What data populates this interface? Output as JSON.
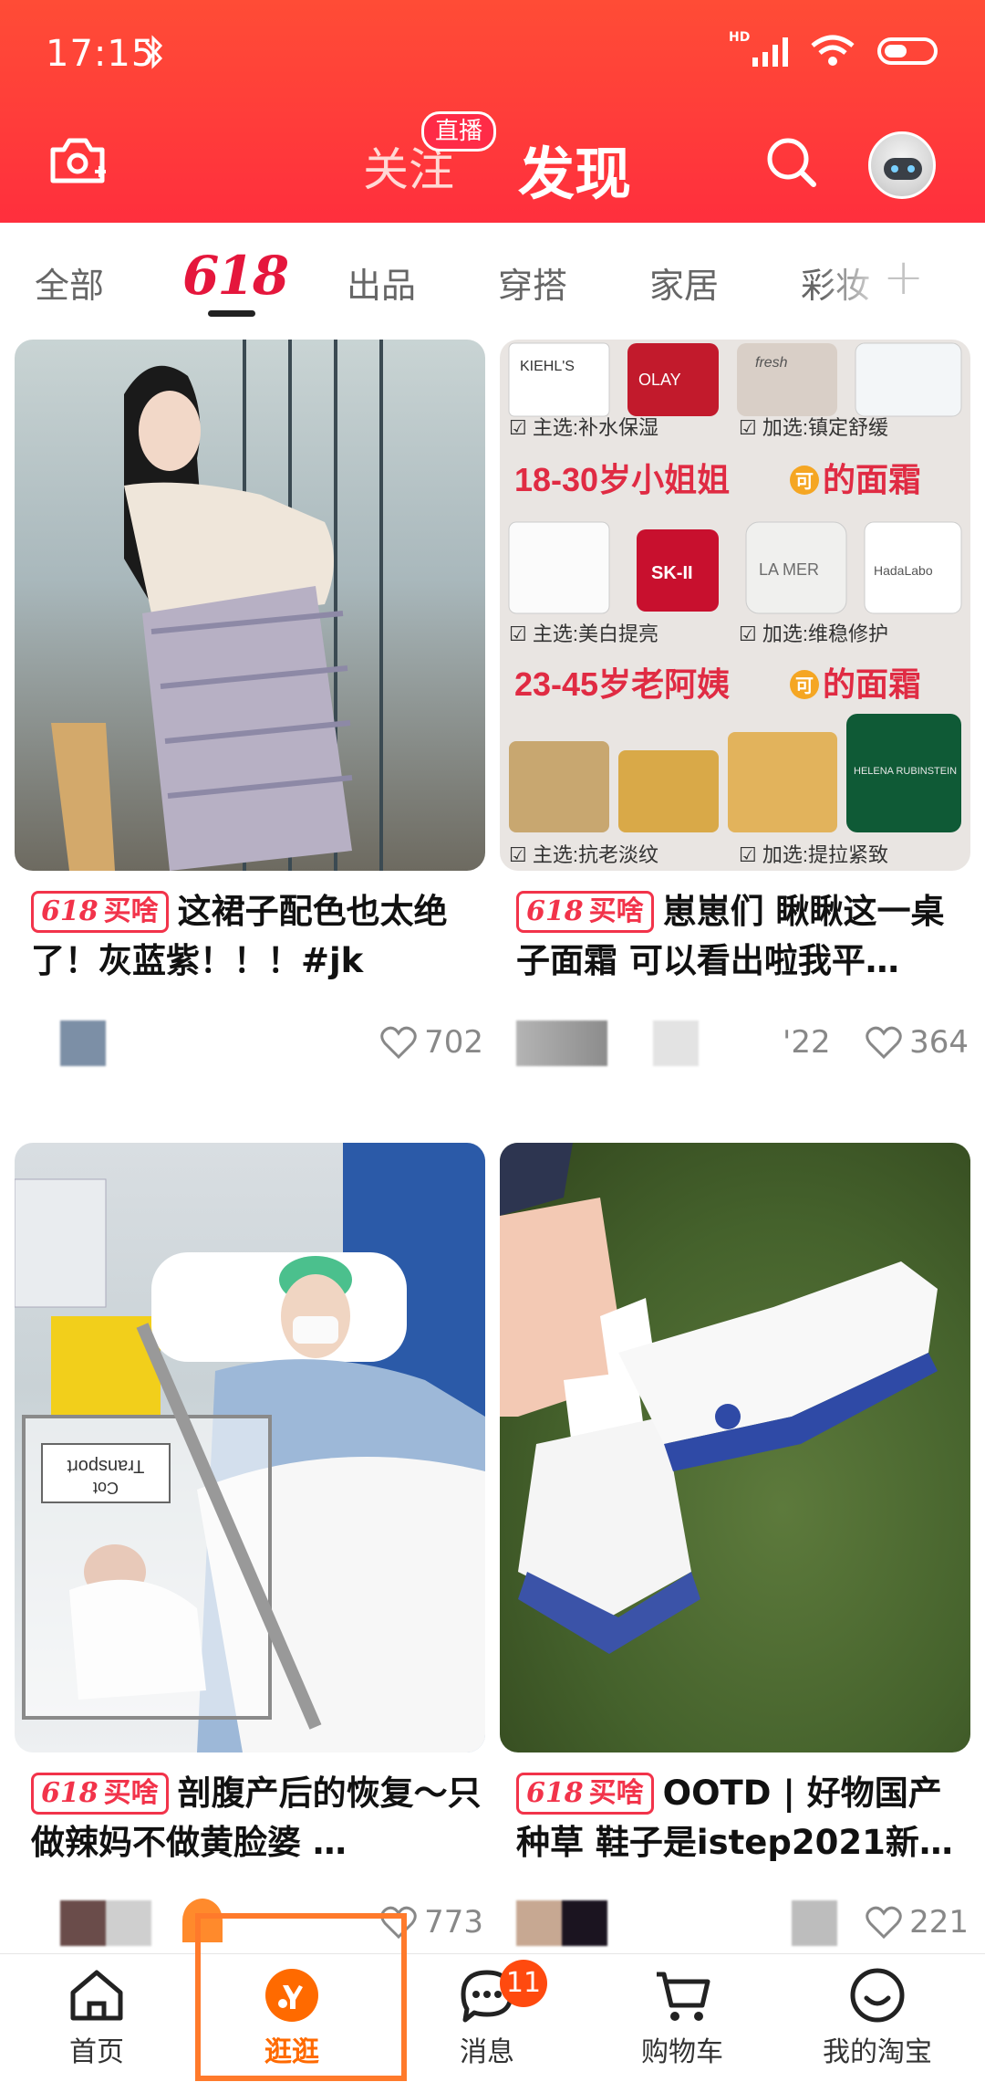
{
  "status_bar": {
    "time": "17:15",
    "network": "HD"
  },
  "header": {
    "follow_label": "关注",
    "live_badge": "直播",
    "discover_label": "发现"
  },
  "tabs": [
    "全部",
    "618",
    "出品",
    "穿搭",
    "家居",
    "彩妆"
  ],
  "cards": [
    {
      "tag_num": "618",
      "tag_text": "买啥",
      "title": "这裙子配色也太绝了！灰蓝紫！！！#jk",
      "likes": "702",
      "image": "girl-in-school-uniform"
    },
    {
      "tag_num": "618",
      "tag_text": "买啥",
      "title": "崽崽们 瞅瞅这一桌子面霜 可以看出啦我平…",
      "extra_count": "'22",
      "likes": "364",
      "image": "face-cream-collection",
      "image_text": {
        "row1_left": "☑ 主选:补水保湿",
        "row1_right": "☑ 加选:镇定舒缓",
        "headline1": "18-30岁小姐姐",
        "headline1_badge": "可",
        "headline1_tail": "的面霜",
        "row2_left": "☑ 主选:美白提亮",
        "row2_right": "☑ 加选:维稳修护",
        "headline2": "23-45岁老阿姨",
        "headline2_badge": "可",
        "headline2_tail": "的面霜",
        "row3_left": "☑ 主选:抗老淡纹",
        "row3_right": "☑ 加选:提拉紧致",
        "brands": [
          "KIEHL'S",
          "OLAY",
          "fresh",
          "SK-II",
          "LA MER",
          "HadaLabo",
          "HELENA RUBINSTEIN"
        ]
      }
    },
    {
      "tag_num": "618",
      "tag_text": "买啥",
      "title": "剖腹产后的恢复～只做辣妈不做黄脸婆 …",
      "likes": "773",
      "image": "hospital-mother-baby",
      "image_text": {
        "sign1": "Transport",
        "sign2": "Cot"
      }
    },
    {
      "tag_num": "618",
      "tag_text": "买啥",
      "title": "OOTD | 好物国产种草 鞋子是istep2021新…",
      "likes": "221",
      "image": "white-sneakers-on-grass"
    }
  ],
  "bottom_nav": [
    {
      "label": "首页",
      "icon": "home-icon"
    },
    {
      "label": "逛逛",
      "icon": "guangguang-icon",
      "active": true
    },
    {
      "label": "消息",
      "icon": "message-icon",
      "badge": "11"
    },
    {
      "label": "购物车",
      "icon": "cart-icon"
    },
    {
      "label": "我的淘宝",
      "icon": "profile-icon"
    }
  ],
  "colors": {
    "header_red": "#ff2f3d",
    "accent_red": "#f2334a",
    "active_orange": "#ff6a00",
    "highlight_orange": "#ff7a2b"
  }
}
